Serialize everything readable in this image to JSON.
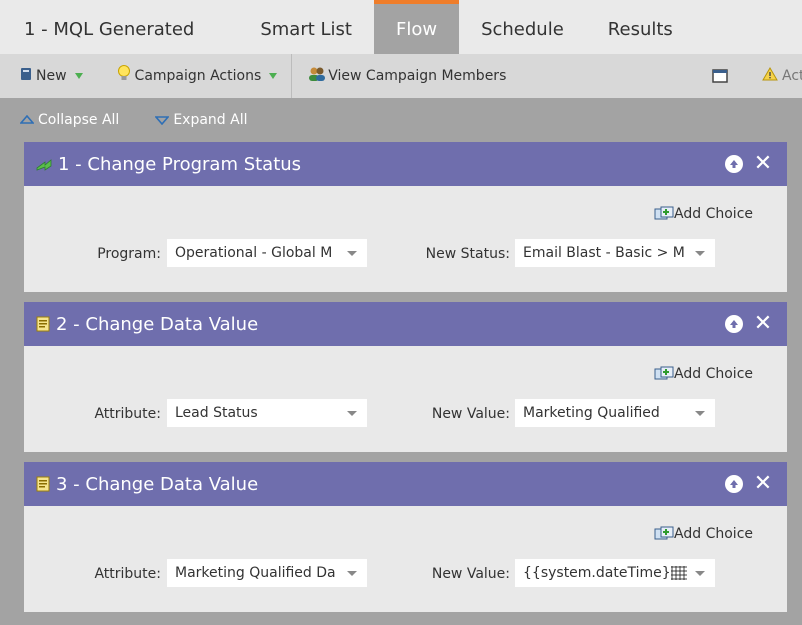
{
  "tabs": [
    {
      "label": "1 - MQL Generated"
    },
    {
      "label": "Smart List"
    },
    {
      "label": "Flow"
    },
    {
      "label": "Schedule"
    },
    {
      "label": "Results"
    }
  ],
  "active_tab": "Flow",
  "toolbar": {
    "new_label": "New",
    "campaign_actions_label": "Campaign Actions",
    "view_members_label": "View Campaign Members",
    "truncated_label": "Act",
    "accent_color": "#ef7d2a"
  },
  "collapse": {
    "collapse_label": "Collapse All",
    "expand_label": "Expand All"
  },
  "flow_steps": [
    {
      "title": "1 - Change Program Status",
      "icon": "program-status-icon",
      "add_choice": "Add Choice",
      "left_label": "Program:",
      "left_value": "Operational - Global M",
      "right_label": "New Status:",
      "right_value": "Email Blast - Basic > Ma"
    },
    {
      "title": "2 - Change Data Value",
      "icon": "data-value-icon",
      "add_choice": "Add Choice",
      "left_label": "Attribute:",
      "left_value": "Lead Status",
      "right_label": "New Value:",
      "right_value": "Marketing Qualified"
    },
    {
      "title": "3 - Change Data Value",
      "icon": "data-value-icon",
      "add_choice": "Add Choice",
      "left_label": "Attribute:",
      "left_value": "Marketing Qualified Da",
      "right_label": "New Value:",
      "right_value": "{{system.dateTime}}"
    }
  ],
  "colors": {
    "header_purple": "#6f6ead",
    "background_gray": "#a3a3a3",
    "card_body": "#e9e9e9"
  }
}
